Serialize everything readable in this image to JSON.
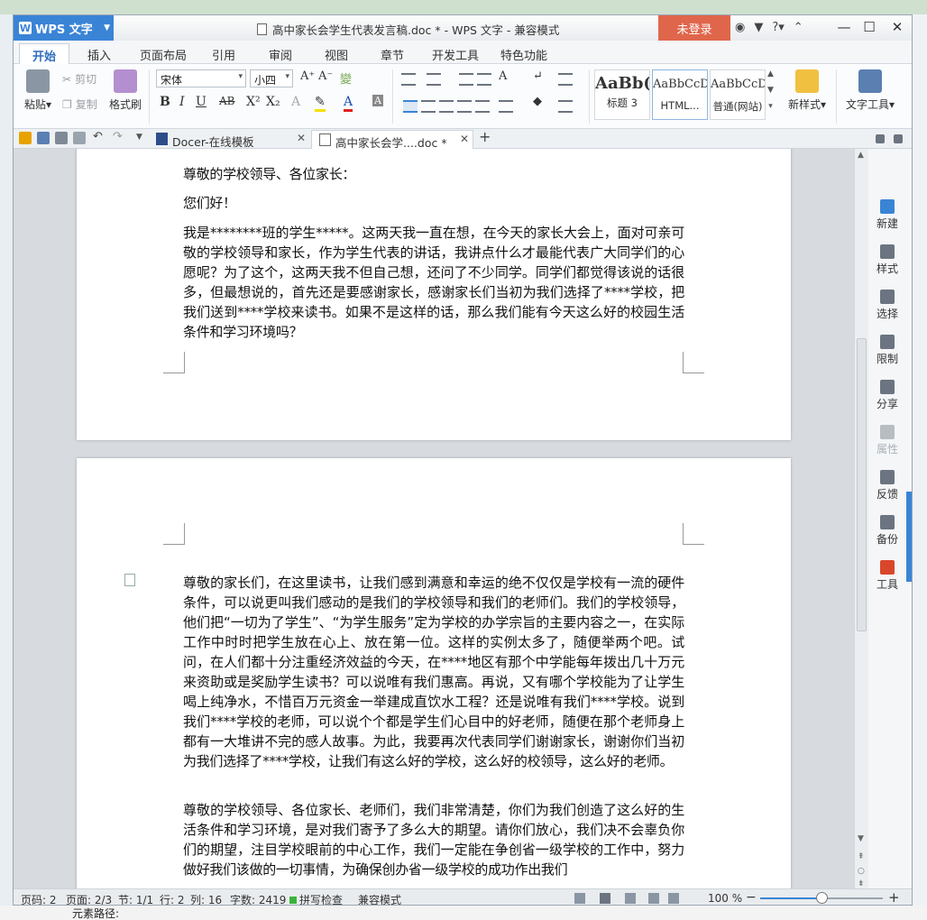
{
  "window": {
    "app_name": "WPS 文字",
    "title": "高中家长会学生代表发言稿.doc * - WPS 文字 - 兼容模式",
    "login": "未登录",
    "title_icons": [
      "shield-icon",
      "shirt-icon",
      "help-icon",
      "collapse-icon"
    ],
    "help_label": "?"
  },
  "menu": {
    "items": [
      "开始",
      "插入",
      "页面布局",
      "引用",
      "审阅",
      "视图",
      "章节",
      "开发工具",
      "特色功能"
    ]
  },
  "ribbon": {
    "paste": "粘贴",
    "cut": "剪切",
    "copy": "复制",
    "format_painter": "格式刷",
    "font_name": "宋体",
    "font_size": "小四",
    "styles": [
      {
        "preview": "AaBb(",
        "label": "标题 3"
      },
      {
        "preview": "AaBbCcD",
        "label": "HTML..."
      },
      {
        "preview": "AaBbCcD",
        "label": "普通(网站)"
      }
    ],
    "new_style": "新样式",
    "text_tools": "文字工具"
  },
  "tabs": [
    {
      "label": "Docer-在线模板",
      "active": false
    },
    {
      "label": "高中家长会学....doc *",
      "active": true
    }
  ],
  "document": {
    "page1_paragraphs": [
      "尊敬的学校领导、各位家长：",
      "您们好！",
      "我是********班的学生*****。这两天我一直在想，在今天的家长大会上，面对可亲可敬的学校领导和家长，作为学生代表的讲话，我讲点什么才最能代表广大同学们的心愿呢？为了这个，这两天我不但自己想，还问了不少同学。同学们都觉得该说的话很多，但最想说的，首先还是要感谢家长，感谢家长们当初为我们选择了****学校，把我们送到****学校来读书。如果不是这样的话，那么我们能有今天这么好的校园生活条件和学习环境吗？"
    ],
    "page2_paragraphs": [
      "尊敬的家长们，在这里读书，让我们感到满意和幸运的绝不仅仅是学校有一流的硬件条件，可以说更叫我们感动的是我们的学校领导和我们的老师们。我们的学校领导，他们把“一切为了学生”、“为学生服务”定为学校的办学宗旨的主要内容之一，在实际工作中时时把学生放在心上、放在第一位。这样的实例太多了，随便举两个吧。试问，在人们都十分注重经济效益的今天，在****地区有那个中学能每年拨出几十万元来资助或是奖励学生读书？可以说唯有我们惠高。再说，又有哪个学校能为了让学生喝上纯净水，不惜百万元资金一举建成直饮水工程？还是说唯有我们****学校。说到我们****学校的老师，可以说个个都是学生们心目中的好老师，随便在那个老师身上都有一大堆讲不完的感人故事。为此，我要再次代表同学们谢谢家长，谢谢你们当初为我们选择了****学校，让我们有这么好的学校，这么好的校领导，这么好的老师。",
      "尊敬的学校领导、各位家长、老师们，我们非常清楚，你们为我们创造了这么好的生活条件和学习环境，是对我们寄予了多么大的期望。请你们放心，我们决不会辜负你们的期望，注目学校眼前的中心工作，我们一定能在争创省一级学校的工作中，努力做好我们该做的一切事情，为确保创办省一级学校的成功作出我们"
    ]
  },
  "sidepanel": {
    "items": [
      {
        "label": "新建",
        "icon": "new-doc-icon",
        "enabled": true,
        "color": "#3a84d6"
      },
      {
        "label": "样式",
        "icon": "style-icon",
        "enabled": true,
        "color": "#6b7480"
      },
      {
        "label": "选择",
        "icon": "select-icon",
        "enabled": true,
        "color": "#6b7480"
      },
      {
        "label": "限制",
        "icon": "restrict-icon",
        "enabled": true,
        "color": "#6b7480"
      },
      {
        "label": "分享",
        "icon": "share-icon",
        "enabled": true,
        "color": "#6b7480"
      },
      {
        "label": "属性",
        "icon": "properties-icon",
        "enabled": false,
        "color": "#b7bdc3"
      },
      {
        "label": "反馈",
        "icon": "feedback-icon",
        "enabled": true,
        "color": "#6b7480"
      },
      {
        "label": "备份",
        "icon": "backup-icon",
        "enabled": true,
        "color": "#6b7480"
      },
      {
        "label": "工具",
        "icon": "toolbox-icon",
        "enabled": true,
        "color": "#d9472b"
      }
    ]
  },
  "statusbar": {
    "page_num": "页码: 2",
    "pages": "页面: 2/3",
    "section": "节: 1/1",
    "row": "行: 2",
    "col": "列: 16",
    "words": "字数: 2419",
    "spell": "拼写检查",
    "compat": "兼容模式",
    "zoom": "100 %"
  },
  "background": {
    "bottom_text": "元素路径:"
  }
}
